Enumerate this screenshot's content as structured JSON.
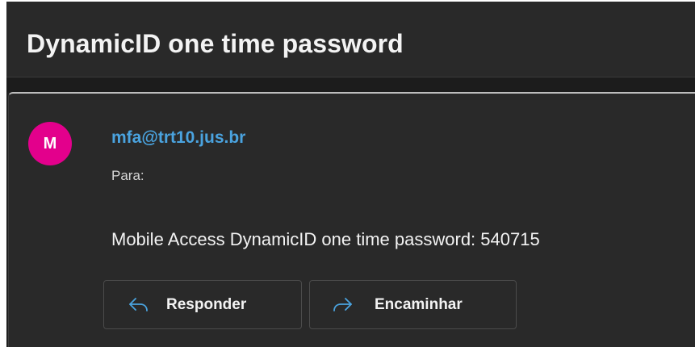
{
  "email": {
    "subject": "DynamicID one time password",
    "sender": {
      "initial": "M",
      "address": "mfa@trt10.jus.br",
      "avatar_color": "#e3008c"
    },
    "to_label": "Para:",
    "body": "Mobile Access DynamicID one time password: 540715"
  },
  "actions": {
    "reply": {
      "label": "Responder",
      "icon": "reply-arrow-icon"
    },
    "forward": {
      "label": "Encaminhar",
      "icon": "forward-arrow-icon"
    }
  },
  "colors": {
    "background": "#292929",
    "sender_link": "#4aa3df",
    "text": "#f3f3f3"
  }
}
